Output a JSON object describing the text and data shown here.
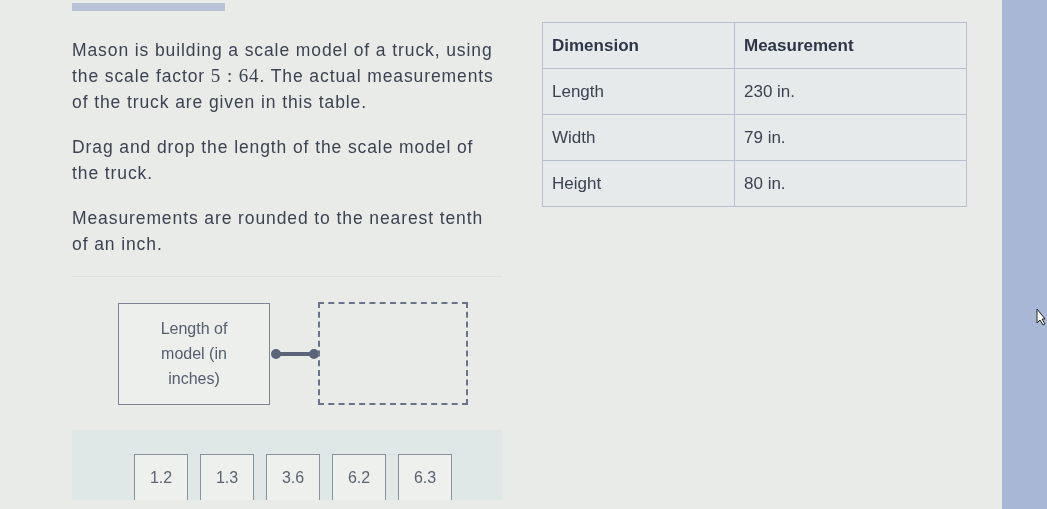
{
  "question": {
    "paragraphs": [
      {
        "before": "Mason is building a scale model of a truck, using the scale factor ",
        "math": "5 : 64",
        "after": ". The actual measurements of the truck are given in this table."
      },
      {
        "before": "Drag and drop the length of the scale model of the truck."
      },
      {
        "before": "Measurements are rounded to the nearest tenth of an inch."
      }
    ]
  },
  "table": {
    "columns": [
      "Dimension",
      "Measurement"
    ],
    "rows": [
      [
        "Length",
        "230 in."
      ],
      [
        "Width",
        "79 in."
      ],
      [
        "Height",
        "80 in."
      ]
    ]
  },
  "match": {
    "label": "Length of model (in inches)"
  },
  "choices": [
    "1.2",
    "1.3",
    "3.6",
    "6.2",
    "6.3"
  ]
}
